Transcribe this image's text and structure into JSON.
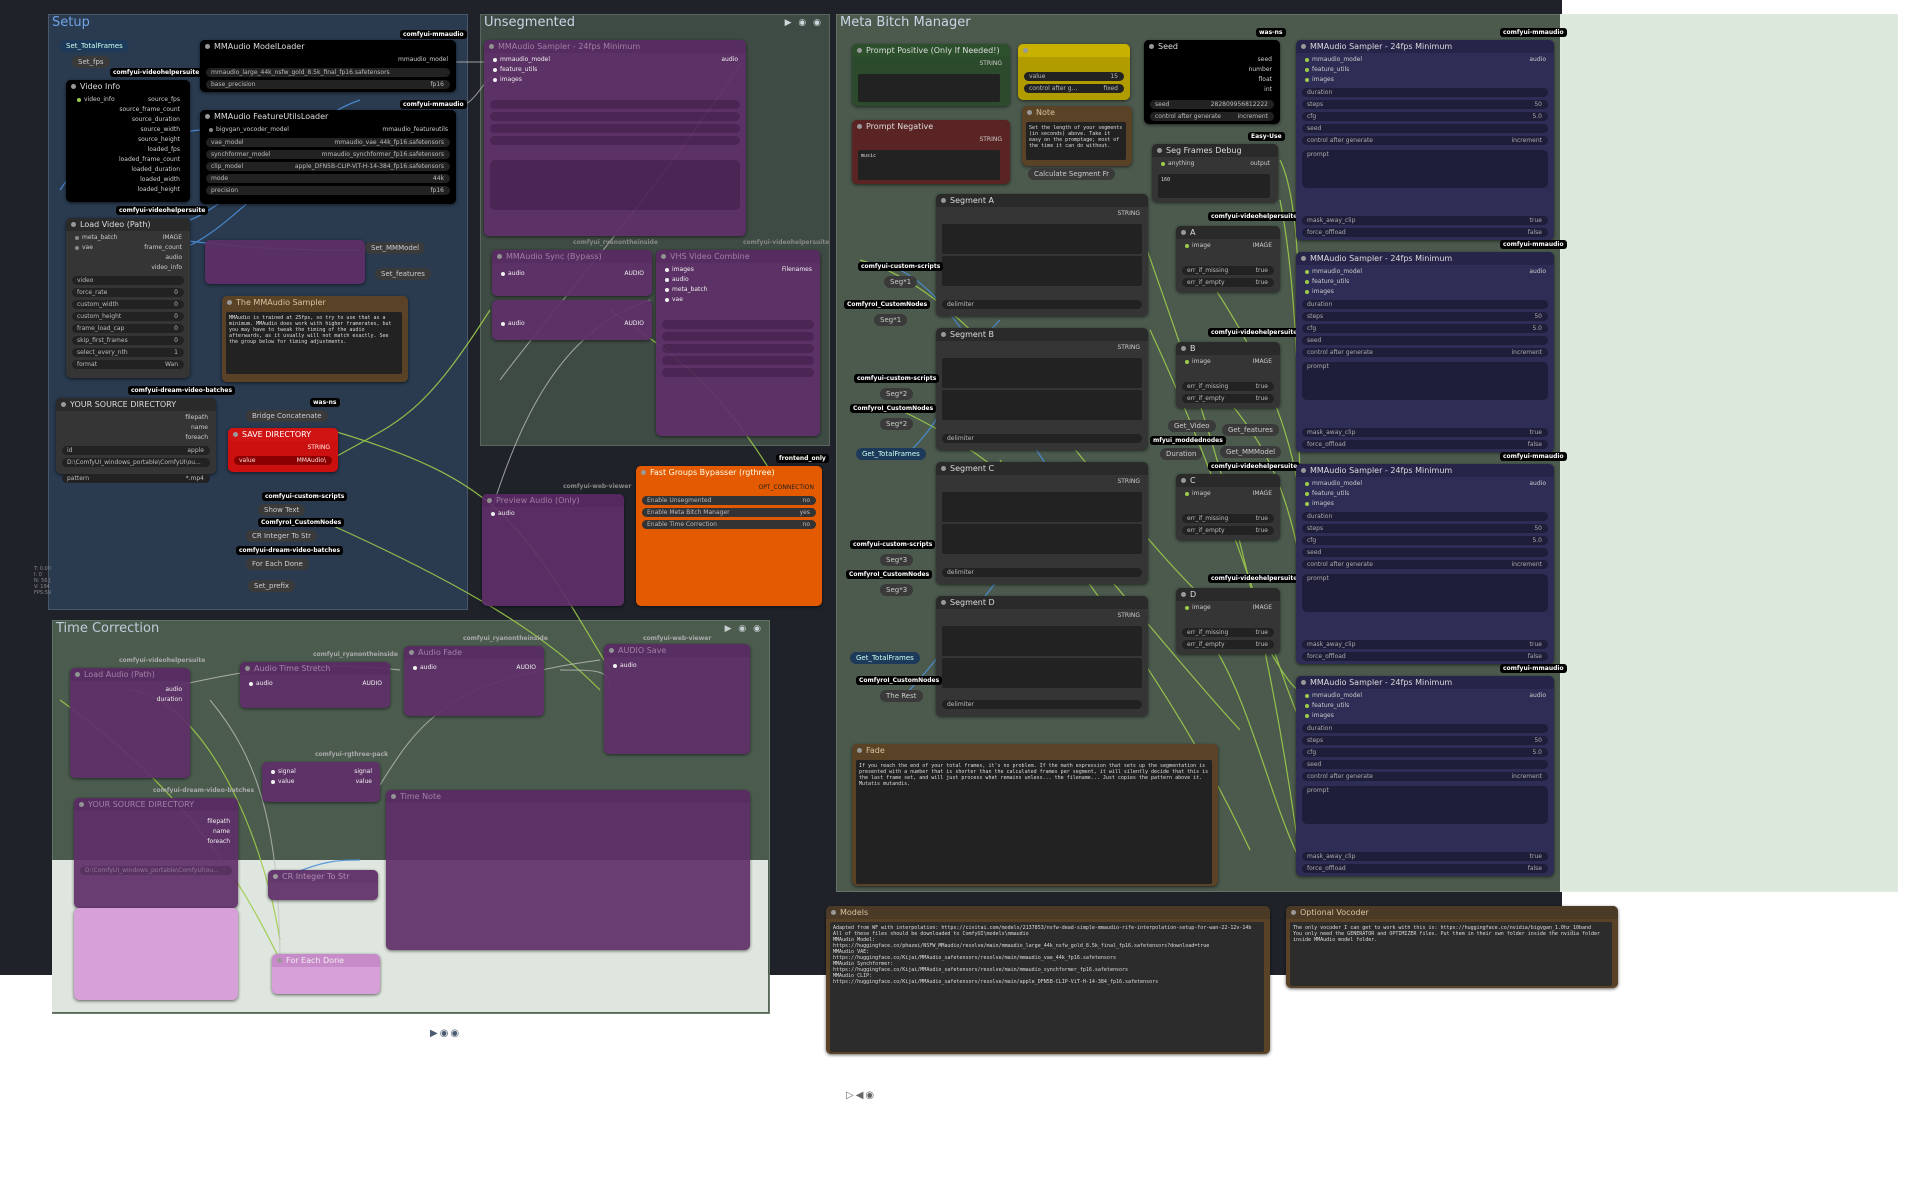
{
  "groups": {
    "setup": "Setup",
    "unsegmented": "Unsegmented",
    "meta": "Meta Bitch Manager",
    "time": "Time Correction"
  },
  "colors": {
    "canvas": "#1f2329",
    "wire_green": "#9ccc4a",
    "wire_white": "#c0c0c0",
    "wire_blue": "#4a90d9"
  },
  "setup": {
    "set_total_frames": "Set_TotalFrames",
    "set_fps": "Set_fps",
    "video_info": {
      "title": "Video Info",
      "tag": "comfyui-videohelpersuite",
      "in": "video_info",
      "outs": [
        "source_fps",
        "source_frame_count",
        "source_duration",
        "source_width",
        "source_height",
        "loaded_fps",
        "loaded_frame_count",
        "loaded_duration",
        "loaded_width",
        "loaded_height"
      ]
    },
    "model_loader": {
      "title": "MMAudio ModelLoader",
      "tag": "comfyui-mmaudio",
      "out": "mmaudio_model",
      "model": "mmaudio_large_44k_nsfw_gold_8.5k_final_fp16.safetensors",
      "base_precision": "base_precision",
      "base_precision_val": "fp16"
    },
    "feature_loader": {
      "title": "MMAudio FeatureUtilsLoader",
      "tag": "comfyui-mmaudio",
      "in": "bigvgan_vocoder_model",
      "out": "mmaudio_featureutils",
      "rows": [
        {
          "label": "vae_model",
          "value": "mmaudio_vae_44k_fp16.safetensors"
        },
        {
          "label": "synchformer_model",
          "value": "mmaudio_synchformer_fp16.safetensors"
        },
        {
          "label": "clip_model",
          "value": "apple_DFN5B-CLIP-ViT-H-14-384_fp16.safetensors"
        },
        {
          "label": "mode",
          "value": "44k"
        },
        {
          "label": "precision",
          "value": "fp16"
        }
      ]
    },
    "load_video": {
      "title": "Load Video (Path)",
      "tag": "comfyui-videohelpersuite",
      "ins": [
        "meta_batch",
        "vae"
      ],
      "outs": [
        "IMAGE",
        "frame_count",
        "audio",
        "video_info"
      ],
      "rows": [
        {
          "label": "video",
          "value": ""
        },
        {
          "label": "force_rate",
          "value": "0"
        },
        {
          "label": "custom_width",
          "value": "0"
        },
        {
          "label": "custom_height",
          "value": "0"
        },
        {
          "label": "frame_load_cap",
          "value": "0"
        },
        {
          "label": "skip_first_frames",
          "value": "0"
        },
        {
          "label": "select_every_nth",
          "value": "1"
        },
        {
          "label": "format",
          "value": "Wan"
        }
      ]
    },
    "set_mmmodel": "Set_MMModel",
    "set_features": "Set_features",
    "sampler_note": {
      "title": "The MMAudio Sampler",
      "text": "MMAudio is trained at 25fps, so try to use that as a minimum. MMAudio does work with higher framerates, but you may have to tweak the timing of the audio afterwards, as it usually will not match exactly. See the group below for timing adjustments."
    },
    "source_dir": {
      "title": "YOUR SOURCE DIRECTORY",
      "tag": "comfyui-dream-video-batches",
      "outs": [
        "filepath",
        "name",
        "foreach"
      ],
      "id": "id",
      "id_val": "apple",
      "path": "D:\\ComfyUI_windows_portable\\ComfyUI\\ou...",
      "pattern": "pattern",
      "pattern_val": "*.mp4"
    },
    "bridge": "Bridge Concatenate",
    "bridge_tag": "was-ns",
    "save_dir": {
      "title": "SAVE DIRECTORY",
      "out": "STRING",
      "value_label": "value",
      "value": "MMAudio\\"
    },
    "show_text": "Show Text",
    "show_text_tag": "comfyui-custom-scripts",
    "cr_integer": "CR Integer To Str",
    "cr_tag": "ComfyroI_CustomNodes",
    "for_each": "For Each Done",
    "for_each_tag": "comfyui-dream-video-batches",
    "set_prefix": "Set_prefix",
    "sidebar_text": [
      "T: 0.00",
      "I: 0",
      "N: 56 [",
      "V: 194",
      "FPS:59"
    ]
  },
  "unseg": {
    "sampler_title": "MMAudio Sampler - 24fps Minimum",
    "sampler_out": "audio",
    "sampler_ins": [
      "mmaudio_model",
      "feature_utils",
      "images"
    ],
    "vhs_tag": "comfyui-videohelpersuite",
    "sync_title": "MMAudio Sync (Bypass)",
    "combine_title": "VHS Video Combine",
    "combine_ins": [
      "images",
      "audio",
      "meta_batch",
      "vae"
    ],
    "combine_out": "Filenames",
    "audio_label": "audio",
    "audio_out": "AUDIO",
    "preview_title": "Preview Audio (Only)",
    "preview_in": "audio",
    "tags": [
      "comfyui_ryanontheinside",
      "comfyui-videohelpersuite",
      "comfyui-web-viewer"
    ]
  },
  "fast_groups": {
    "title": "Fast Groups Bypasser (rgthree)",
    "tag": "frontend_only",
    "out": "OPT_CONNECTION",
    "rows": [
      {
        "label": "Enable Unsegmented",
        "value": "no"
      },
      {
        "label": "Enable Meta Bitch Manager",
        "value": "yes"
      },
      {
        "label": "Enable Time Correction",
        "value": "no"
      }
    ]
  },
  "meta": {
    "prompt_pos": {
      "title": "Prompt Positive (Only If Needed!)",
      "out": "STRING"
    },
    "prompt_neg": {
      "title": "Prompt Negative",
      "out": "STRING",
      "text": "music"
    },
    "yellow_node": {
      "value_label": "value",
      "value": "15",
      "control": "control after g...",
      "control_val": "fixed"
    },
    "seed": {
      "title": "Seed",
      "tag": "was-ns",
      "outs": [
        "seed",
        "number",
        "float",
        "int"
      ],
      "seed_label": "seed",
      "seed_val": "282809956812222",
      "control": "control after generate",
      "control_val": "increment"
    },
    "note": {
      "title": "Note",
      "text": "Set the length of your segments (in seconds) above. Take it easy on the promptage; most of the time it can do without."
    },
    "easy_use": "Easy-Use",
    "seg_debug": {
      "title": "Seg Frames Debug",
      "in": "anything",
      "out": "output",
      "text": "160"
    },
    "calc": "Calculate Segment Fr",
    "segments": [
      {
        "title": "Segment A",
        "out": "STRING",
        "delim": "delimiter"
      },
      {
        "title": "Segment B",
        "out": "STRING",
        "delim": "delimiter"
      },
      {
        "title": "Segment C",
        "out": "STRING",
        "delim": "delimiter"
      },
      {
        "title": "Segment D",
        "out": "STRING",
        "delim": "delimiter"
      }
    ],
    "seg_labels": [
      "Seg*1",
      "Seg*1",
      "Seg*2",
      "Seg*2",
      "Seg*3",
      "Seg*3"
    ],
    "seg_tags": [
      "comfyui-custom-scripts",
      "ComfyroI_CustomNodes",
      "comfyui-custom-scripts",
      "ComfyroI_CustomNodes",
      "comfyui-custom-scripts",
      "ComfyroI_CustomNodes",
      "ComfyroI_CustomNodes"
    ],
    "get_total": "Get_TotalFrames",
    "get_total2": "Get_TotalFrames",
    "the_rest": "The Rest",
    "selectors": [
      {
        "title": "A",
        "in": "image",
        "out": "IMAGE"
      },
      {
        "title": "B",
        "in": "image",
        "out": "IMAGE"
      },
      {
        "title": "C",
        "in": "image",
        "out": "IMAGE"
      },
      {
        "title": "D",
        "in": "image",
        "out": "IMAGE"
      }
    ],
    "sel_rows": [
      {
        "label": "indexes",
        "value": ""
      },
      {
        "label": "err_if_missing",
        "value": "true"
      },
      {
        "label": "err_if_empty",
        "value": "true"
      }
    ],
    "sel_tag": "comfyui-videohelpersuite",
    "get_video": "Get_Video",
    "get_features": "Get_features",
    "get_mmmodel": "Get_MMModel",
    "duration": "Duration",
    "duration_tag": "mfyui_moddednodes",
    "samplers": [
      {
        "title": "MMAudio Sampler - 24fps Minimum"
      },
      {
        "title": "MMAudio Sampler - 24fps Minimum"
      },
      {
        "title": "MMAudio Sampler - 24fps Minimum"
      },
      {
        "title": "MMAudio Sampler - 24fps Minimum"
      }
    ],
    "sampler_tag": "comfyui-mmaudio",
    "sampler_ins": [
      "mmaudio_model",
      "feature_utils",
      "images"
    ],
    "sampler_out": "audio",
    "sampler_rows": [
      {
        "label": "duration",
        "value": ""
      },
      {
        "label": "steps",
        "value": "50"
      },
      {
        "label": "cfg",
        "value": "5.0"
      },
      {
        "label": "seed",
        "value": ""
      },
      {
        "label": "control after generate",
        "value": "increment"
      },
      {
        "label": "prompt",
        "value": ""
      },
      {
        "label": "negative_prompt",
        "value": ""
      },
      {
        "label": "mask_away_clip",
        "value": "true"
      },
      {
        "label": "force_offload",
        "value": "false"
      }
    ],
    "fade": {
      "title": "Fade",
      "text": "If you reach the end of your total frames, it's no problem. If the math expression that sets up the segmentation is presented with a number that is shorter than the calculated frames per segment, it will silently decide that this is the last frame set, and will just process what remains unless... the filename... Just copies the pattern above it. Mutatis mutandis."
    }
  },
  "time": {
    "load_audio": "Load Audio (Path)",
    "load_out": [
      "audio",
      "duration"
    ],
    "tag1": "comfyui-videohelpersuite",
    "audio_time": "Audio Time Stretch",
    "audio_in": "audio",
    "audio_out": "AUDIO",
    "tag2": "comfyui_ryanontheinside",
    "audio_fade": "Audio Fade",
    "tag3": "comfyui_ryanontheinside",
    "audio_save": "AUDIO Save",
    "tag4": "comfyui-web-viewer",
    "signal_ins": [
      "signal",
      "value"
    ],
    "signal_outs": [
      "signal",
      "value"
    ],
    "signal_tag": "comfyui-rgthree-pack",
    "time_note": "Time Note",
    "source_dir": "YOUR SOURCE DIRECTORY",
    "source_tag": "comfyui-dream-video-batches",
    "source_outs": [
      "filepath",
      "name",
      "foreach"
    ],
    "source_path": "D:\\ComfyUI_windows_portable\\ComfyUI\\ou...",
    "cr": "CR Integer To Str",
    "for_each": "For Each Done"
  },
  "models_note": {
    "title": "Models",
    "lines": [
      "Adapted from WF with interpolation: https://civitai.com/models/2137853/nsfw-dead-simple-mmaudio-rife-interpolation-setup-for-wan-22-12v-14b",
      "All of these files should be downloaded to ComfyUI\\models\\mmaudio",
      "MMAudio Model:",
      "https://huggingface.co/phazei/NSFW_MMaudio/resolve/main/mmaudio_large_44k_nsfw_gold_8.5k_final_fp16.safetensors?download=true",
      "MMAudio VAE:",
      "https://huggingface.co/Kijai/MMAudio_safetensors/resolve/main/mmaudio_vae_44k_fp16.safetensors",
      "MMAudio Synchformer:",
      "https://huggingface.co/Kijai/MMAudio_safetensors/resolve/main/mmaudio_synchformer_fp16.safetensors",
      "MMAudio CLIP:",
      "https://huggingface.co/Kijai/MMAudio_safetensors/resolve/main/apple_DFN5B-CLIP-ViT-H-14-384_fp16.safetensors"
    ]
  },
  "vocoder_note": {
    "title": "Optional Vocoder",
    "lines": [
      "The only vocoder I can get to work with this is: https://huggingface.co/nvidia/bigvgan_1.0hz_10band",
      "You only need the GENERATOR and OPTIMIZER files. Put them in their own folder inside the nvidia folder inside MMAudio model folder."
    ]
  }
}
